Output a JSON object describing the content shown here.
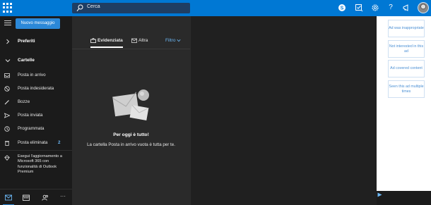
{
  "header": {
    "search_placeholder": "Cerca",
    "icons": [
      "app-launcher-icon",
      "search-icon",
      "skype-icon",
      "todo-icon",
      "settings-icon",
      "help-icon",
      "announcement-icon"
    ],
    "help_glyph": "?"
  },
  "nav": {
    "new_message": "Nuovo messaggio",
    "favorites": "Preferiti",
    "folders_heading": "Cartelle",
    "folders": [
      {
        "label": "Posta in arrivo",
        "icon": "inbox-icon"
      },
      {
        "label": "Posta indesiderata",
        "icon": "junk-icon"
      },
      {
        "label": "Bozze",
        "icon": "drafts-icon"
      },
      {
        "label": "Posta inviata",
        "icon": "sent-icon"
      },
      {
        "label": "Programmata",
        "icon": "scheduled-icon"
      },
      {
        "label": "Posta eliminata",
        "icon": "trash-icon",
        "count": "2"
      }
    ],
    "upgrade_text": "Esegui l'aggiornamento a Microsoft 365 con funzionalità di Outlook Premium",
    "bottom": [
      "mail-icon",
      "calendar-icon",
      "people-icon",
      "more-icon"
    ],
    "more_glyph": "···"
  },
  "list": {
    "tab_focused": "Evidenziata",
    "tab_other": "Altra",
    "filter": "Filtro",
    "empty_title": "Per oggi è tutto!",
    "empty_subtitle": "La cartella Posta in arrivo vuota è tutta per te."
  },
  "ads": {
    "feedback": [
      "Ad was inappropriate",
      "Not interested in this ad",
      "Ad covered content",
      "Seen this ad multiple times"
    ]
  },
  "colors": {
    "accent": "#0078d4",
    "button": "#2b88d8",
    "link": "#6cb8f6",
    "nav_bg": "#1b1b1b",
    "list_bg": "#2a2a2a"
  }
}
